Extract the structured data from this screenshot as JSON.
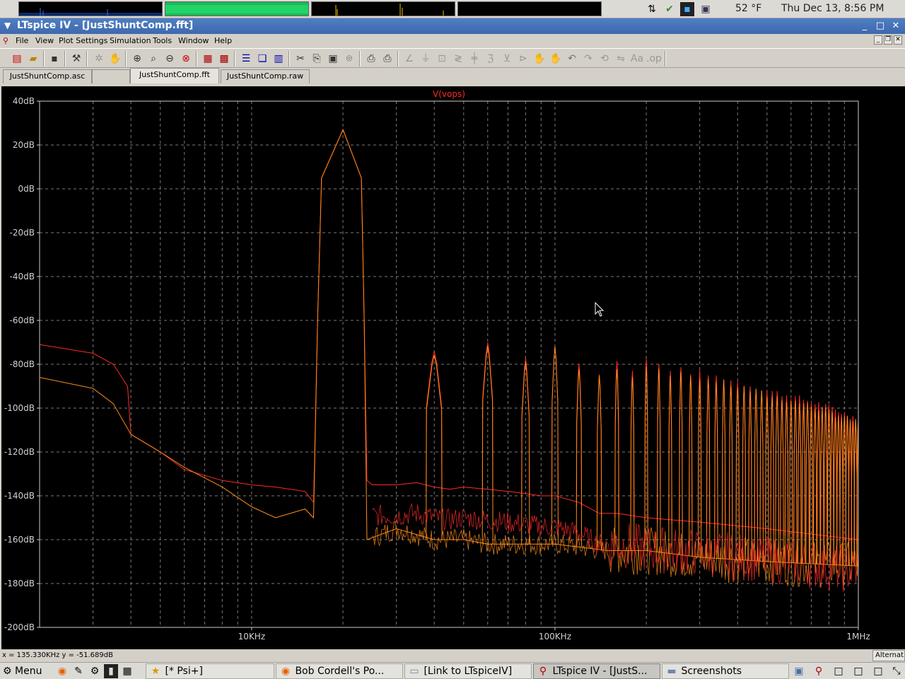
{
  "system_panel": {
    "weather": "52 °F",
    "clock": "Thu Dec 13,  8:56 PM"
  },
  "window": {
    "title": "LTspice IV - [JustShuntComp.fft]",
    "minimize": "_",
    "maximize": "□",
    "close": "✕"
  },
  "menu": {
    "items": [
      "File",
      "View",
      "Plot Settings",
      "Simulation",
      "Tools",
      "Window",
      "Help"
    ]
  },
  "tabs": [
    {
      "label": "JustShuntComp.asc"
    },
    {
      "label": ""
    },
    {
      "label": "JustShuntComp.fft"
    },
    {
      "label": "JustShuntComp.raw"
    }
  ],
  "plot": {
    "trace_label": "V(vops)",
    "trace_color": "#ff2a2a",
    "trace2_color": "#ff8c1a",
    "background": "#000000"
  },
  "chart_data": {
    "type": "line",
    "title": "V(vops)",
    "x_scale": "log",
    "xlim": [
      2000,
      1000000
    ],
    "ylim": [
      -200,
      40
    ],
    "y_ticks": [
      "40dB",
      "20dB",
      "0dB",
      "-20dB",
      "-40dB",
      "-60dB",
      "-80dB",
      "-100dB",
      "-120dB",
      "-140dB",
      "-160dB",
      "-180dB",
      "-200dB"
    ],
    "y_tick_values": [
      40,
      20,
      0,
      -20,
      -40,
      -60,
      -80,
      -100,
      -120,
      -140,
      -160,
      -180,
      -200
    ],
    "x_ticks": [
      "10KHz",
      "100KHz",
      "1MHz"
    ],
    "x_tick_values": [
      10000,
      100000,
      1000000
    ],
    "grid": true,
    "fundamental_hz": 20000,
    "series": [
      {
        "color": "#ff2a2a",
        "x": [
          2000,
          3000,
          3500,
          3900,
          4000,
          5000,
          6000,
          8000,
          10000,
          12000,
          15000,
          16000,
          16500,
          17000,
          20000,
          23000,
          23500,
          24000,
          25000,
          30000,
          35000,
          40000,
          45000,
          50000,
          60000,
          70000,
          80000,
          90000,
          100000,
          120000,
          140000,
          160000,
          200000,
          300000,
          500000,
          1000000
        ],
        "y": [
          -71,
          -75,
          -80,
          -90,
          -112,
          -120,
          -128,
          -133,
          -135,
          -136,
          -138,
          -143,
          -60,
          5,
          27,
          5,
          -60,
          -133,
          -135,
          -135,
          -134,
          -136,
          -137,
          -136,
          -137,
          -138,
          -139,
          -140,
          -140,
          -143,
          -148,
          -148,
          -150,
          -152,
          -155,
          -160
        ]
      },
      {
        "color": "#ff8c1a",
        "x": [
          2000,
          3000,
          3500,
          4000,
          5000,
          6000,
          8000,
          10000,
          12000,
          15000,
          16000,
          16500,
          17000,
          20000,
          23000,
          23500,
          24000,
          30000,
          40000,
          50000,
          60000,
          80000,
          100000,
          150000,
          200000,
          300000,
          500000,
          1000000
        ],
        "y": [
          -86,
          -91,
          -98,
          -112,
          -120,
          -127,
          -136,
          -145,
          -150,
          -146,
          -150,
          -60,
          5,
          27,
          5,
          -60,
          -160,
          -155,
          -160,
          -160,
          -162,
          -162,
          -162,
          -165,
          -165,
          -168,
          -170,
          -172
        ]
      }
    ],
    "harmonics": [
      {
        "harmonic": 2,
        "freq_hz": 40000,
        "peak_db": -74
      },
      {
        "harmonic": 3,
        "freq_hz": 60000,
        "peak_db": -69
      },
      {
        "harmonic": 4,
        "freq_hz": 80000,
        "peak_db": -77
      },
      {
        "harmonic": 5,
        "freq_hz": 100000,
        "peak_db": -71
      },
      {
        "harmonic": 6,
        "freq_hz": 120000,
        "peak_db": -80
      },
      {
        "harmonic": 7,
        "freq_hz": 140000,
        "peak_db": -84
      },
      {
        "harmonic": 8,
        "freq_hz": 160000,
        "peak_db": -79
      },
      {
        "harmonic": 9,
        "freq_hz": 180000,
        "peak_db": -83
      },
      {
        "harmonic": 10,
        "freq_hz": 200000,
        "peak_db": -78
      },
      {
        "harmonic": 12,
        "freq_hz": 240000,
        "peak_db": -82
      },
      {
        "harmonic": 15,
        "freq_hz": 300000,
        "peak_db": -84
      },
      {
        "harmonic": 20,
        "freq_hz": 400000,
        "peak_db": -88
      },
      {
        "harmonic": 25,
        "freq_hz": 500000,
        "peak_db": -92
      },
      {
        "harmonic": 35,
        "freq_hz": 700000,
        "peak_db": -97
      },
      {
        "harmonic": 50,
        "freq_hz": 1000000,
        "peak_db": -105
      }
    ]
  },
  "status": {
    "coords": "x = 135.330KHz    y = -51.689dB",
    "right_text": "Alternat"
  },
  "taskbar": {
    "start": "Menu",
    "tasks": [
      {
        "label": "[* Psi+]",
        "icon": "star-icon"
      },
      {
        "label": "Bob Cordell's Po...",
        "icon": "firefox-icon"
      },
      {
        "label": "[Link to LTspiceIV]",
        "icon": "folder-icon"
      },
      {
        "label": "LTspice IV - [JustS...",
        "icon": "ltspice-icon"
      },
      {
        "label": "Screenshots",
        "icon": "folder-icon"
      }
    ]
  }
}
